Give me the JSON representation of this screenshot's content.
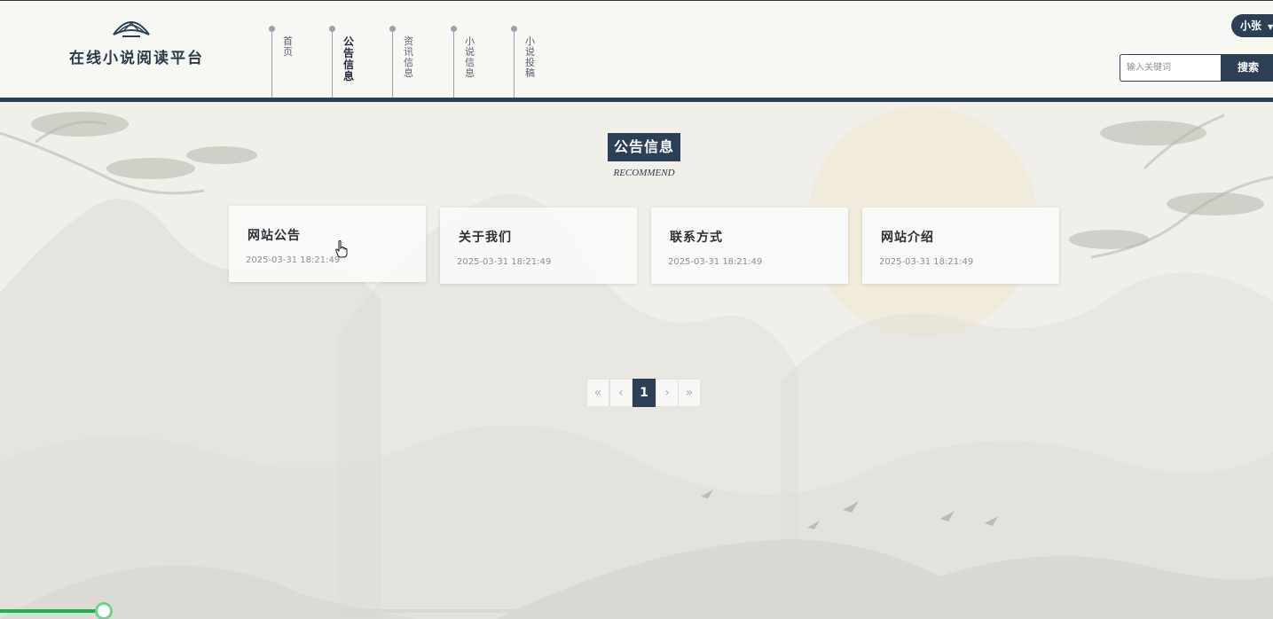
{
  "header": {
    "site_title": "在线小说阅读平台",
    "nav": [
      {
        "label": "首页",
        "active": false
      },
      {
        "label": "公告信息",
        "active": true
      },
      {
        "label": "资讯信息",
        "active": false
      },
      {
        "label": "小说信息",
        "active": false
      },
      {
        "label": "小说投稿",
        "active": false
      }
    ],
    "user_name": "小张",
    "search": {
      "placeholder": "输入关键词",
      "button_label": "搜索"
    }
  },
  "section": {
    "title": "公告信息",
    "subtitle": "RECOMMEND"
  },
  "cards": [
    {
      "title": "网站公告",
      "date": "2025-03-31 18:21:49"
    },
    {
      "title": "关于我们",
      "date": "2025-03-31 18:21:49"
    },
    {
      "title": "联系方式",
      "date": "2025-03-31 18:21:49"
    },
    {
      "title": "网站介绍",
      "date": "2025-03-31 18:21:49"
    }
  ],
  "pagination": {
    "first": "«",
    "prev": "‹",
    "current": "1",
    "next": "›",
    "last": "»"
  },
  "colors": {
    "primary": "#2c3f55",
    "progress": "#1fb24a",
    "background": "#f0efe9"
  },
  "icons": {
    "logo": "fan-book-icon",
    "cursor": "hand-pointer-icon",
    "dropdown": "caret-down-icon"
  },
  "progress": {
    "fraction": 0.082
  }
}
